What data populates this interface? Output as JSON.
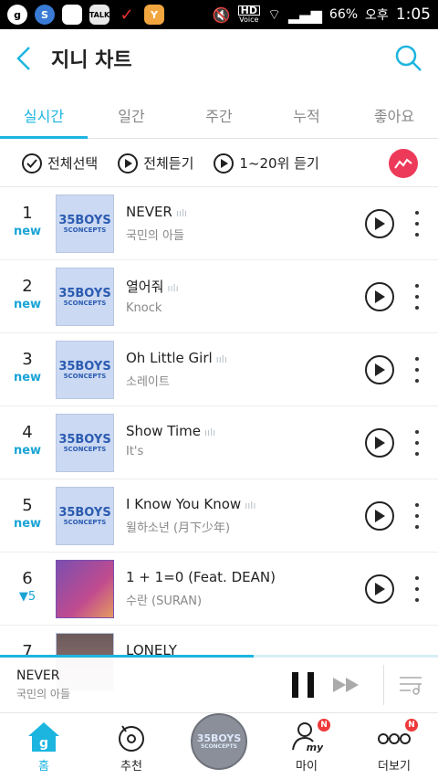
{
  "statusbar": {
    "network": "HD",
    "network_sub": "Voice",
    "battery": "66%",
    "ampm": "오후",
    "time": "1:05",
    "app_icons": [
      "g",
      "S",
      "",
      "TALK",
      "✓",
      "Y"
    ]
  },
  "header": {
    "title": "지니 차트"
  },
  "tabs": [
    {
      "label": "실시간",
      "active": true
    },
    {
      "label": "일간",
      "active": false
    },
    {
      "label": "주간",
      "active": false
    },
    {
      "label": "누적",
      "active": false
    },
    {
      "label": "좋아요",
      "active": false
    }
  ],
  "controls": {
    "select_all": "전체선택",
    "play_all": "전체듣기",
    "play_range": "1~20위 듣기"
  },
  "songs": [
    {
      "rank": "1",
      "status": "new",
      "title": "NEVER",
      "artist": "국민의 아들",
      "art": "35BOYS",
      "art_sub": "5CONCEPTS"
    },
    {
      "rank": "2",
      "status": "new",
      "title": "열어줘",
      "artist": "Knock",
      "art": "35BOYS",
      "art_sub": "5CONCEPTS"
    },
    {
      "rank": "3",
      "status": "new",
      "title": "Oh Little Girl",
      "artist": "소레이트",
      "art": "35BOYS",
      "art_sub": "5CONCEPTS"
    },
    {
      "rank": "4",
      "status": "new",
      "title": "Show Time",
      "artist": "It's",
      "art": "35BOYS",
      "art_sub": "5CONCEPTS"
    },
    {
      "rank": "5",
      "status": "new",
      "title": "I Know You Know",
      "artist": "윌하소년 (月下少年)",
      "art": "35BOYS",
      "art_sub": "5CONCEPTS"
    },
    {
      "rank": "6",
      "status": "▼5",
      "title": "1 + 1=0 (Feat. DEAN)",
      "artist": "수란 (SURAN)",
      "art": "",
      "art_sub": ""
    },
    {
      "rank": "7",
      "status": "",
      "title": "LONELY",
      "artist": "",
      "art": "",
      "art_sub": ""
    }
  ],
  "player": {
    "title": "NEVER",
    "artist": "국민의 아들",
    "progress": 0.58
  },
  "bottomnav": {
    "home": "홈",
    "recommend": "추천",
    "center_art": "35BOYS",
    "center_art_sub": "5CONCEPTS",
    "my": "마이",
    "more": "더보기",
    "badge": "N"
  }
}
